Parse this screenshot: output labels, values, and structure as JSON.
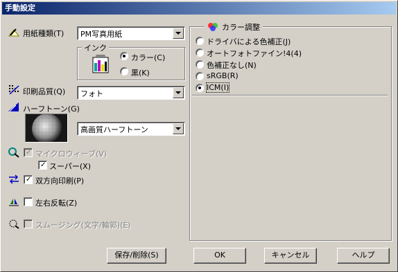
{
  "title": "手動設定",
  "paper": {
    "label": "用紙種類(T)",
    "value": "PM写真用紙"
  },
  "ink": {
    "group_label": "インク",
    "color": "カラー(C)",
    "black": "黒(K)",
    "selected": "color"
  },
  "quality": {
    "label": "印刷品質(Q)",
    "value": "フォト"
  },
  "halftone": {
    "label": "ハーフトーン(G)",
    "value": "高画質ハーフトーン"
  },
  "microweave": {
    "label": "マイクロウィーブ(V)",
    "checked": true,
    "enabled": false
  },
  "super": {
    "label": "スーパー(X)",
    "checked": true
  },
  "bidirectional": {
    "label": "双方向印刷(P)",
    "checked": true
  },
  "mirror": {
    "label": "左右反転(Z)",
    "checked": false
  },
  "smoothing": {
    "label": "スムージング(文字/輪郭)(E)",
    "checked": false,
    "enabled": false
  },
  "color_adjust": {
    "group_label": "カラー調整",
    "options": [
      "ドライバによる色補正(J)",
      "オートフォトファイン!4(4)",
      "色補正なし(N)",
      "sRGB(R)",
      "ICM(I)"
    ],
    "selected_index": 4
  },
  "buttons": {
    "save": "保存/削除(S)",
    "ok": "OK",
    "cancel": "キャンセル",
    "help": "ヘルプ"
  }
}
